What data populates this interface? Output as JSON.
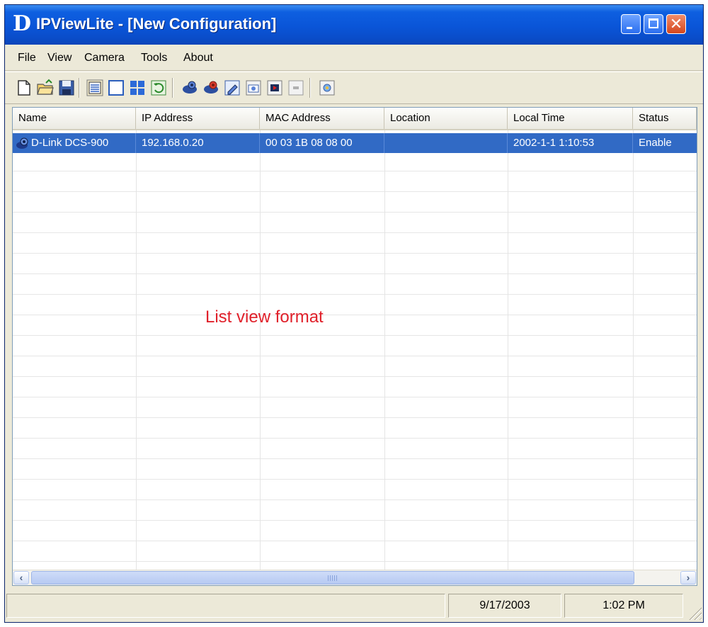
{
  "window": {
    "logo_letter": "D",
    "title": "IPViewLite - [New Configuration]"
  },
  "menu": {
    "items": [
      "File",
      "View",
      "Camera",
      "Tools",
      "About"
    ]
  },
  "toolbar": {
    "icons": [
      "new-file-icon",
      "open-folder-icon",
      "save-icon",
      "list-view-icon",
      "single-view-icon",
      "quad-view-icon",
      "refresh-icon",
      "add-camera-icon",
      "remove-camera-icon",
      "edit-camera-icon",
      "snapshot-icon",
      "record-icon",
      "stop-icon",
      "settings-icon"
    ]
  },
  "list": {
    "columns": [
      "Name",
      "IP Address",
      "MAC Address",
      "Location",
      "Local Time",
      "Status"
    ],
    "rows": [
      {
        "name": "D-Link DCS-900",
        "ip": "192.168.0.20",
        "mac": "00 03 1B 08 08 00",
        "location": "",
        "local_time": "2002-1-1  1:10:53",
        "status": "Enable"
      }
    ],
    "selected_color": "#316ac5",
    "overlay_label": "List view format"
  },
  "statusbar": {
    "main": "",
    "date": "9/17/2003",
    "time": "1:02 PM"
  },
  "colors": {
    "titlebar": "#0a55d8",
    "window_bg": "#ece9d8",
    "overlay_text": "#e0202a"
  }
}
